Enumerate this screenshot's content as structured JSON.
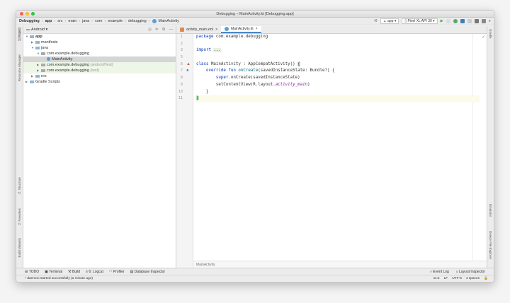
{
  "window": {
    "title": "Debugging – MainActivity.kt [Debugging.app]"
  },
  "breadcrumb": [
    "Debugging",
    "app",
    "src",
    "main",
    "java",
    "com",
    "example",
    "debugging",
    "MainActivity"
  ],
  "toolbar": {
    "run_config": "app",
    "device": "Pixel XL API 30"
  },
  "project": {
    "view": "Android",
    "tree": [
      {
        "label": "app",
        "depth": 0,
        "arrow": "▼",
        "bold": true
      },
      {
        "label": "manifests",
        "depth": 1,
        "arrow": "▶"
      },
      {
        "label": "java",
        "depth": 1,
        "arrow": "▼"
      },
      {
        "label": "com.example.debugging",
        "depth": 2,
        "arrow": "▼",
        "pkg": true
      },
      {
        "label": "MainActivity",
        "depth": 3,
        "arrow": "",
        "selected": true
      },
      {
        "label": "com.example.debugging",
        "suffix": "(androidTest)",
        "depth": 2,
        "arrow": "▶",
        "pkg": true,
        "test": true
      },
      {
        "label": "com.example.debugging",
        "suffix": "(test)",
        "depth": 2,
        "arrow": "▶",
        "pkg": true,
        "test": true
      },
      {
        "label": "res",
        "depth": 1,
        "arrow": "▶"
      },
      {
        "label": "Gradle Scripts",
        "depth": 0,
        "arrow": "▶"
      }
    ]
  },
  "left_strip": [
    "1: Project",
    "Resource Manager",
    "Z: Structure",
    "2: Favorites",
    "Build Variants"
  ],
  "right_strip": [
    "Gradle",
    "Emulator",
    "Device File Explorer"
  ],
  "editor": {
    "tabs": [
      {
        "label": "activity_main.xml",
        "active": false
      },
      {
        "label": "MainActivity.kt",
        "active": true
      }
    ],
    "lines": [
      "1",
      "2",
      "3",
      "5",
      "6",
      "7",
      "8",
      "9",
      "10",
      "11"
    ],
    "footer": "MainActivity"
  },
  "bottom_tools": {
    "left": [
      "TODO",
      "Terminal",
      "Build",
      "6: Logcat",
      "Profiler",
      "Database Inspector"
    ],
    "right": [
      "Event Log",
      "Layout Inspector"
    ]
  },
  "status": {
    "message": "* daemon started successfully (a minute ago)",
    "position": "11:2",
    "line_sep": "LF",
    "encoding": "UTF-8",
    "indent": "4 spaces"
  }
}
